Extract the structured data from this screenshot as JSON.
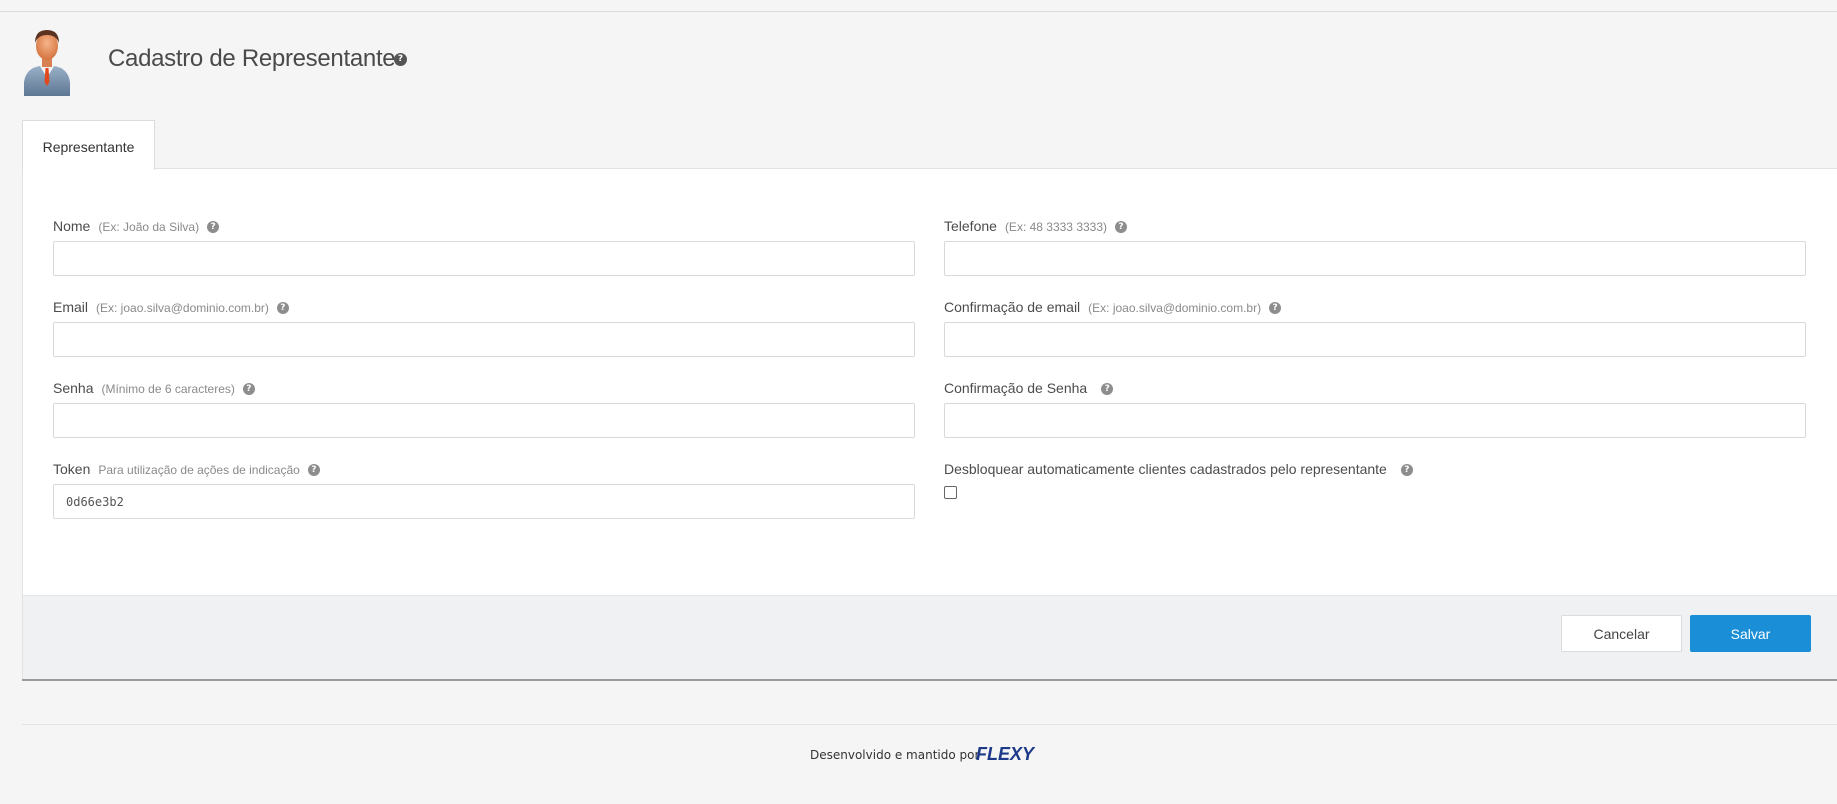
{
  "header": {
    "title": "Cadastro de Representante"
  },
  "tabs": [
    {
      "label": "Representante"
    }
  ],
  "form": {
    "nome": {
      "label": "Nome",
      "hint": "(Ex: João da Silva)",
      "value": ""
    },
    "telefone": {
      "label": "Telefone",
      "hint": "(Ex: 48 3333 3333)",
      "value": ""
    },
    "email": {
      "label": "Email",
      "hint": "(Ex: joao.silva@dominio.com.br)",
      "value": ""
    },
    "confirmacao_email": {
      "label": "Confirmação de email",
      "hint": "(Ex: joao.silva@dominio.com.br)",
      "value": ""
    },
    "senha": {
      "label": "Senha",
      "hint": "(Mínimo de 6 caracteres)",
      "value": ""
    },
    "confirmacao_senha": {
      "label": "Confirmação de Senha",
      "hint": "",
      "value": ""
    },
    "token": {
      "label": "Token",
      "hint": "Para utilização de ações de indicação",
      "value": "0d66e3b2"
    },
    "desbloquear": {
      "label": "Desbloquear automaticamente clientes cadastrados pelo representante",
      "checked": false
    }
  },
  "actions": {
    "cancel_label": "Cancelar",
    "save_label": "Salvar"
  },
  "footer": {
    "credit": "Desenvolvido e mantido por",
    "brand": "FLEXY"
  },
  "colors": {
    "accent": "#1a8fd8",
    "background": "#f5f5f5",
    "brand_dark": "#1d3a8a",
    "brand_light": "#2bb8d4"
  },
  "icons": {
    "help": "question-circle-icon",
    "avatar": "representative-avatar-icon"
  }
}
